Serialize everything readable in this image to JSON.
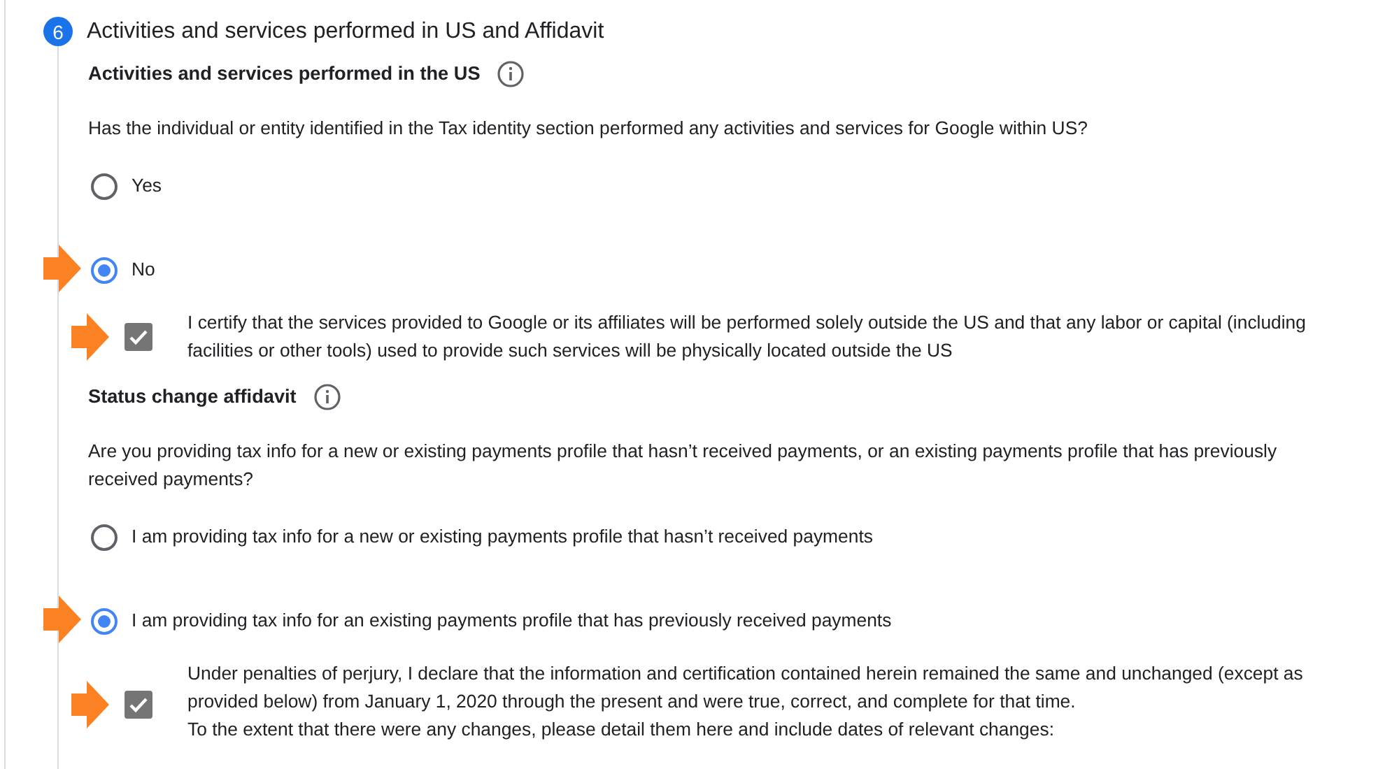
{
  "step": {
    "number": "6",
    "title": "Activities and services performed in US and Affidavit"
  },
  "sections": [
    {
      "title": "Activities and services performed in the US",
      "question": "Has the individual or entity identified in the Tax identity section performed any activities and services for Google within US?",
      "options": [
        {
          "label": "Yes",
          "selected": false,
          "highlighted": false
        },
        {
          "label": "No",
          "selected": true,
          "highlighted": true
        }
      ],
      "certification": {
        "lines": [
          "I certify that the services provided to Google or its affiliates will be performed solely outside the US and that any labor or capital (including facilities or other tools) used to provide such services will be physically located outside the US"
        ],
        "checked": true,
        "disabled": true,
        "highlighted": true
      }
    },
    {
      "title": "Status change affidavit",
      "question": "Are you providing tax info for a new or existing payments profile that hasn’t received payments, or an existing payments profile that has previously received payments?",
      "options": [
        {
          "label": "I am providing tax info for a new or existing payments profile that hasn’t received payments",
          "selected": false,
          "highlighted": false
        },
        {
          "label": "I am providing tax info for an existing payments profile that has previously received payments",
          "selected": true,
          "highlighted": true
        }
      ],
      "certification": {
        "lines": [
          "Under penalties of perjury, I declare that the information and certification contained herein remained the same and unchanged (except as provided below) from January 1, 2020 through the present and were true, correct, and complete for that time.",
          "To the extent that there were any changes, please detail them here and include dates of relevant changes:"
        ],
        "checked": true,
        "disabled": true,
        "highlighted": true
      }
    }
  ]
}
